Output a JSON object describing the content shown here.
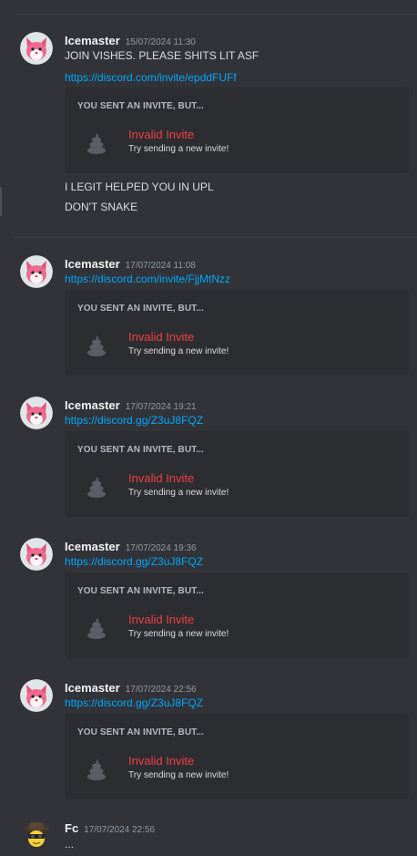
{
  "messages": [
    {
      "author": "Icemaster",
      "timestamp": "15/07/2024 11:30",
      "lines": [
        "JOIN VISHES. PLEASE SHITS LIT ASF"
      ],
      "link": "https://discord.com/invite/epddFUFf",
      "embed": {
        "heading": "YOU SENT AN INVITE, BUT...",
        "title": "Invalid Invite",
        "subtitle": "Try sending a new invite!"
      },
      "after_lines": [
        "I LEGIT HELPED YOU IN UPL",
        "DON'T SNAKE"
      ]
    },
    {
      "author": "Icemaster",
      "timestamp": "17/07/2024 11:08",
      "link": "https://discord.com/invite/FjjMtNzz",
      "embed": {
        "heading": "YOU SENT AN INVITE, BUT...",
        "title": "Invalid Invite",
        "subtitle": "Try sending a new invite!"
      }
    },
    {
      "author": "Icemaster",
      "timestamp": "17/07/2024 19:21",
      "link": "https://discord.gg/Z3uJ8FQZ",
      "embed": {
        "heading": "YOU SENT AN INVITE, BUT...",
        "title": "Invalid Invite",
        "subtitle": "Try sending a new invite!"
      }
    },
    {
      "author": "Icemaster",
      "timestamp": "17/07/2024 19:36",
      "link": "https://discord.gg/Z3uJ8FQZ",
      "embed": {
        "heading": "YOU SENT AN INVITE, BUT...",
        "title": "Invalid Invite",
        "subtitle": "Try sending a new invite!"
      }
    },
    {
      "author": "Icemaster",
      "timestamp": "17/07/2024 22:56",
      "link": "https://discord.gg/Z3uJ8FQZ",
      "embed": {
        "heading": "YOU SENT AN INVITE, BUT...",
        "title": "Invalid Invite",
        "subtitle": "Try sending a new invite!"
      }
    },
    {
      "author": "Fc",
      "timestamp": "17/07/2024 22:56",
      "lines": [
        "..."
      ]
    }
  ],
  "colors": {
    "background": "#313338",
    "embed_background": "#2b2d31",
    "link": "#00a8fc",
    "invalid_title": "#f23f43",
    "author": "#f2f3f5",
    "timestamp": "#949ba4"
  },
  "icons": {
    "avatar_icemaster": "pink-cat-avatar",
    "avatar_fc": "yellow-hat-character-avatar",
    "embed_icon": "poop-icon"
  }
}
